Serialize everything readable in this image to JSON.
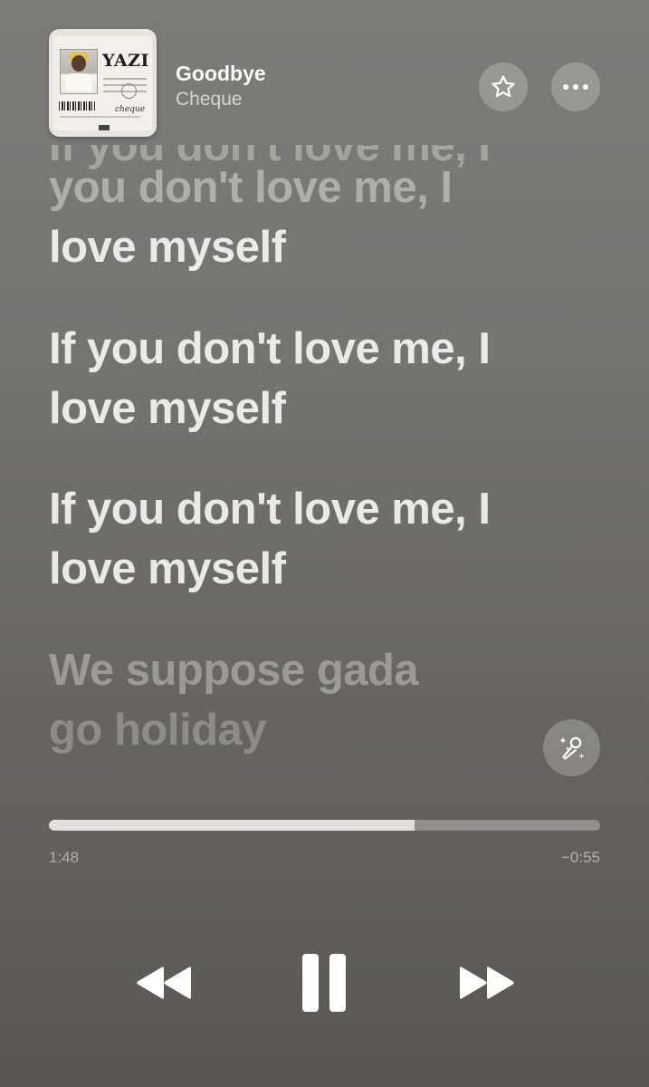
{
  "now_playing": {
    "title": "Goodbye",
    "artist": "Cheque",
    "artwork": {
      "title_text": "YAZI",
      "signature_text": "cheque"
    }
  },
  "lyrics": {
    "cutoff_line": "If you don't love me, I",
    "lines": [
      {
        "line1": "you don't love me, I",
        "line2": "love myself"
      },
      {
        "line1": "If you don't love me, I",
        "line2": "love myself"
      },
      {
        "line1": "If you don't love me, I",
        "line2": "love myself"
      },
      {
        "line1": "We suppose gada",
        "line2": "go holiday"
      }
    ]
  },
  "playback": {
    "elapsed": "1:48",
    "remaining": "−0:55",
    "progress_fraction": 0.6628
  },
  "icons": {
    "favorite": "star-outline-icon",
    "more": "ellipsis-icon",
    "sing": "microphone-sparkle-icon",
    "rewind": "rewind-icon",
    "pause": "pause-icon",
    "fast_forward": "fast-forward-icon"
  },
  "colors": {
    "background_top": "#7c7c7b",
    "background_bottom": "#585756",
    "button_bg": "rgba(255,255,255,0.22)"
  }
}
